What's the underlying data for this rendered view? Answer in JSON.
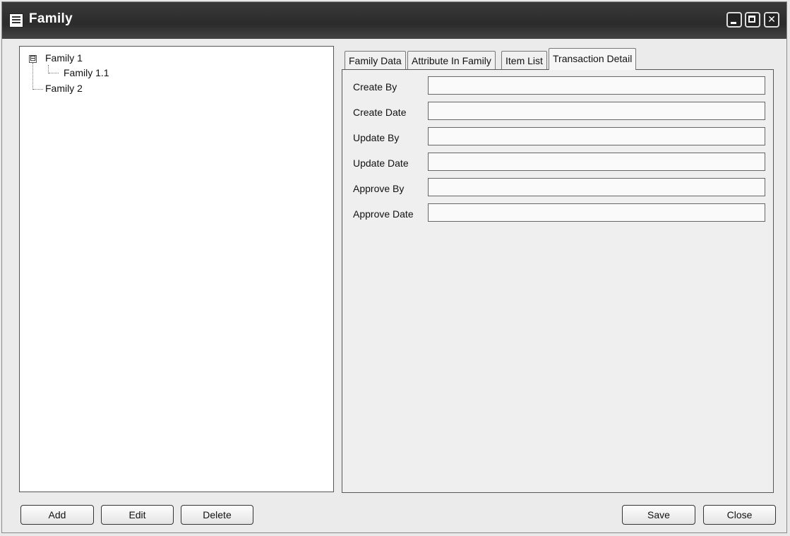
{
  "window": {
    "title": "Family"
  },
  "tree": {
    "nodes": [
      {
        "label": "Family 1",
        "expander": "⊟"
      },
      {
        "label": "Family 1.1"
      },
      {
        "label": "Family 2"
      }
    ]
  },
  "tabs": [
    "Family Data",
    "Attribute In Family",
    "Item List",
    "Transaction Detail"
  ],
  "active_tab": "Transaction Detail",
  "transaction_detail": {
    "fields": [
      {
        "label": "Create By",
        "value": ""
      },
      {
        "label": "Create Date",
        "value": ""
      },
      {
        "label": "Update By",
        "value": ""
      },
      {
        "label": "Update Date",
        "value": ""
      },
      {
        "label": "Approve By",
        "value": ""
      },
      {
        "label": "Approve Date",
        "value": ""
      }
    ]
  },
  "buttons": {
    "add": "Add",
    "edit": "Edit",
    "delete": "Delete",
    "save": "Save",
    "close": "Close"
  }
}
